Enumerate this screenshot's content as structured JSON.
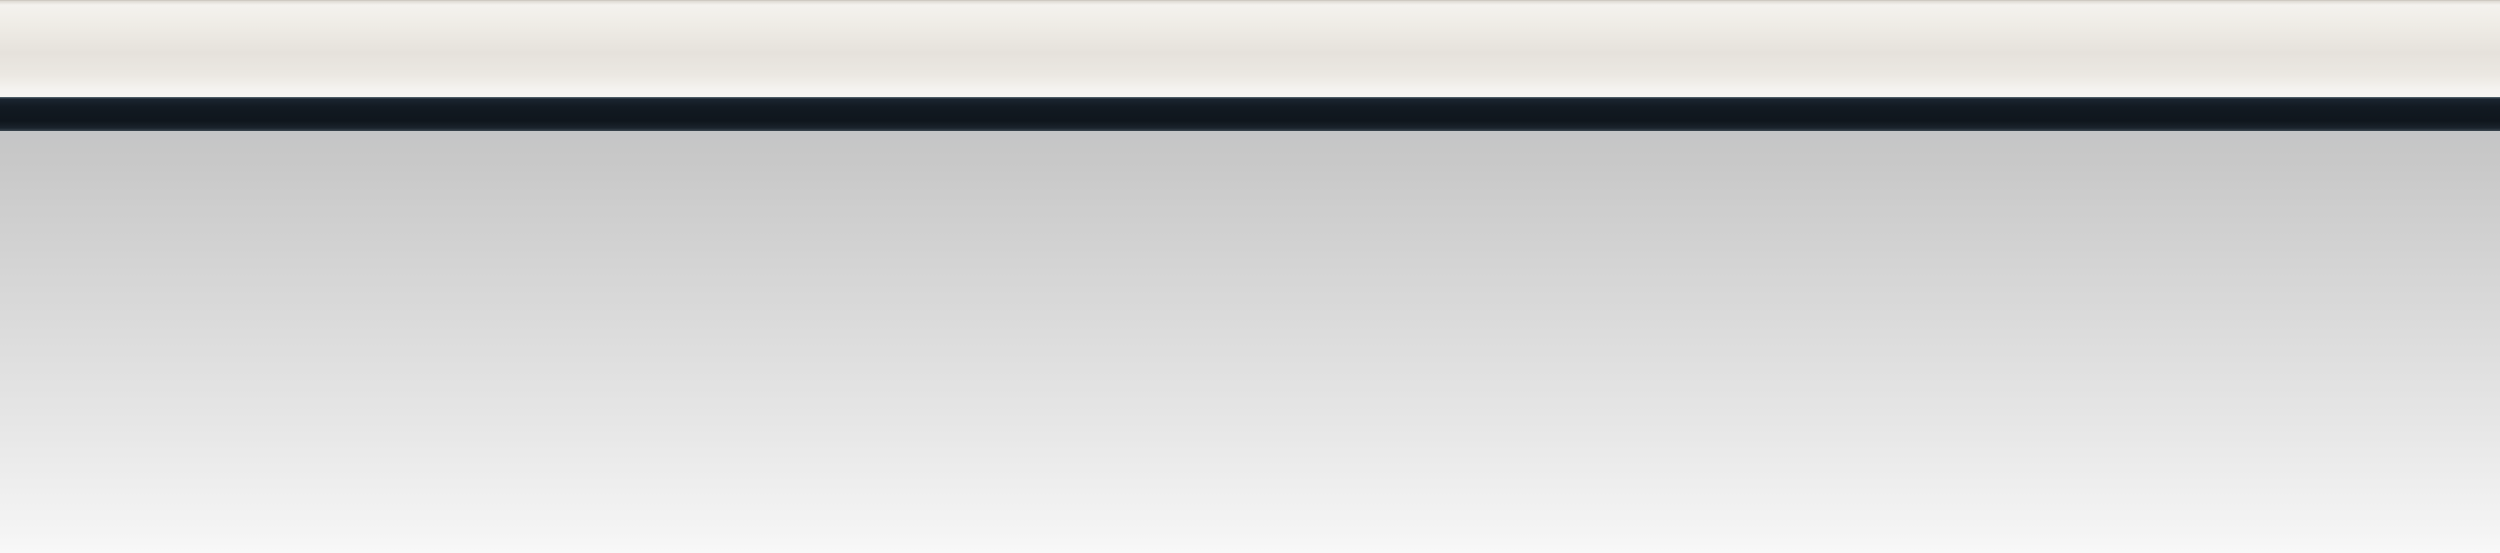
{
  "colors": {
    "top_bar": "#ebe8e2",
    "nav_bar": "#121a22",
    "content_top": "#c7c7c7",
    "content_bottom": "#f8f8f8"
  }
}
